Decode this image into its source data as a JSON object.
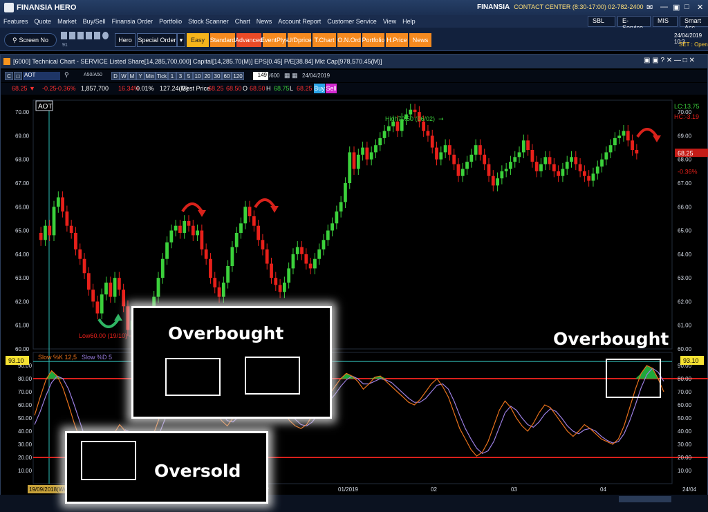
{
  "app": {
    "brand": "FINANSIA HERO",
    "contact_brand": "FINANSIA",
    "contact": "CONTACT CENTER (8:30-17:00) 02-782-2400"
  },
  "menu": [
    "Features",
    "Quote",
    "Market",
    "Buy/Sell",
    "Finansia Order",
    "Portfolio",
    "Stock Scanner",
    "Chart",
    "News",
    "Account Report",
    "Customer Service",
    "View",
    "Help"
  ],
  "menu_right": {
    "sbl": "SBL",
    "eservice": "E-Service",
    "mis": "MIS",
    "smart": "Smart Acc"
  },
  "toolbar": {
    "screen": "Screen No",
    "screen_sub": "91",
    "hero": "Hero",
    "special": "Special Order",
    "modes": [
      "Easy",
      "Standard",
      "Advanced"
    ],
    "links": [
      "EventPlys",
      "U/Dprice",
      "T.Chart",
      "O.N.Ord",
      "Portfolio",
      "H.Price",
      "News"
    ],
    "date": "24/04/2019 10:3",
    "set": "SET : Open"
  },
  "window": {
    "title": "[6000] Technical Chart - SERVICE Listed Share[14,285,700,000] Capital[14,285.70(M)] EPS[0.45] P/E[38.84] Mkt Cap[978,570.45(M)]"
  },
  "chartbar": {
    "symbol": "AOT",
    "ratio": "A50/A50",
    "periods": [
      "D",
      "W",
      "M",
      "Y",
      "Min",
      "Tick",
      "1",
      "3",
      "5",
      "10",
      "20",
      "30",
      "60",
      "120"
    ],
    "bars": "149",
    "bars_total": "/600",
    "date": "24/04/2019"
  },
  "pricebar": {
    "last": "68.25 ▼",
    "chg": "-0.25",
    "pct": "-0.36%",
    "vol": "1,857,700",
    "pct2": "16.34%",
    "pct3": "0.01%",
    "val": "127.24(M)",
    "best_label": "Best Price",
    "best_bid": "68.25",
    "best_ask": "68.50",
    "o_label": "O",
    "o": "68.50",
    "h_label": "H",
    "h": "68.75",
    "l_label": "L",
    "l": "68.25",
    "buy": "Buy",
    "sell": "Sell"
  },
  "colors": {
    "up": "#3bd13b",
    "down": "#e8201a",
    "accent": "#f7941d",
    "k": "#e8711c",
    "d": "#9a7ee0",
    "band": "#d9201b",
    "hc": "#34c6c0"
  },
  "chart_data": {
    "type": "candlestick",
    "symbol": "AOT",
    "price_ticks": [
      "70.00",
      "69.00",
      "68.00",
      "67.00",
      "66.00",
      "65.00",
      "64.00",
      "63.00",
      "62.00",
      "61.00",
      "60.00"
    ],
    "osc_ticks": [
      "90.00",
      "80.00",
      "70.00",
      "60.00",
      "50.00",
      "40.00",
      "30.00",
      "20.00",
      "10.00"
    ],
    "osc_current": "93.10",
    "x_labels": [
      "19/09/2018(Wed)",
      "10",
      "11",
      "12",
      "01/2019",
      "02",
      "03",
      "04",
      "24/04"
    ],
    "lc": "LC:13.75",
    "hc": "HC:-3.19",
    "last_price": "68.25",
    "last_pct": "-0.36%",
    "high_note": "High70.50 (06/02)",
    "low_note": "Low60.00 (19/10)",
    "stoch_k": "Slow %K 12,5",
    "stoch_d": "Slow %D 5",
    "overbought_level": 80,
    "oversold_level": 20,
    "closes": [
      64.6,
      65.2,
      64.8,
      66.0,
      66.4,
      65.8,
      65.2,
      64.9,
      64.2,
      63.8,
      63.2,
      62.5,
      62.0,
      61.5,
      62.3,
      62.8,
      62.2,
      63.0,
      62.5,
      61.8,
      60.8,
      61.2,
      60.5,
      60.2,
      60.8,
      61.5,
      62.2,
      63.0,
      63.8,
      64.5,
      65.0,
      65.2,
      64.9,
      65.4,
      65.2,
      64.8,
      65.0,
      64.2,
      63.8,
      63.0,
      62.6,
      62.2,
      62.8,
      63.5,
      64.3,
      64.9,
      65.3,
      66.0,
      65.6,
      65.2,
      64.6,
      64.2,
      63.6,
      63.0,
      62.7,
      62.4,
      62.8,
      63.4,
      64.0,
      64.3,
      64.0,
      63.6,
      63.4,
      63.8,
      64.2,
      64.6,
      65.0,
      65.3,
      65.8,
      66.2,
      67.0,
      68.3,
      67.6,
      68.2,
      68.5,
      68.0,
      68.3,
      68.6,
      68.9,
      69.2,
      69.4,
      69.6,
      69.2,
      69.7,
      69.9,
      70.1,
      70.0,
      69.6,
      69.2,
      69.0,
      68.5,
      68.0,
      68.3,
      68.6,
      68.2,
      67.8,
      67.3,
      67.6,
      67.9,
      68.2,
      68.6,
      68.2,
      67.8,
      67.3,
      66.9,
      67.2,
      67.5,
      67.6,
      67.9,
      68.1,
      68.3,
      68.8,
      68.4,
      67.9,
      67.5,
      67.8,
      68.1,
      67.8,
      67.5,
      67.3,
      67.6,
      67.9,
      68.1,
      67.8,
      67.5,
      67.3,
      67.1,
      67.4,
      67.7,
      68.0,
      68.3,
      68.6,
      68.9,
      69.0,
      69.2,
      68.8,
      68.4,
      68.25
    ],
    "stoch_k_series": [
      52,
      66,
      79,
      86,
      82,
      73,
      60,
      46,
      34,
      22,
      16,
      12,
      15,
      28,
      38,
      45,
      40,
      33,
      24,
      20,
      26,
      38,
      50,
      60,
      68,
      74,
      82,
      85,
      84,
      79,
      71,
      63,
      55,
      48,
      44,
      50,
      58,
      66,
      74,
      80,
      83,
      80,
      72,
      62,
      54,
      48,
      44,
      42,
      45,
      52,
      58,
      62,
      68,
      74,
      80,
      84,
      82,
      78,
      72,
      76,
      81,
      82,
      78,
      74,
      70,
      66,
      62,
      60,
      64,
      70,
      76,
      80,
      74,
      66,
      54,
      42,
      34,
      26,
      21,
      24,
      32,
      44,
      56,
      63,
      58,
      50,
      44,
      40,
      46,
      54,
      60,
      58,
      52,
      46,
      40,
      36,
      40,
      45,
      42,
      38,
      34,
      32,
      30,
      34,
      44,
      58,
      72,
      84,
      90,
      88,
      80,
      70
    ],
    "stoch_d_series": [
      45,
      55,
      67,
      77,
      82,
      80,
      72,
      60,
      47,
      34,
      24,
      17,
      14,
      18,
      27,
      37,
      41,
      39,
      32,
      26,
      23,
      28,
      38,
      49,
      59,
      67,
      74,
      80,
      84,
      82,
      77,
      70,
      62,
      54,
      48,
      47,
      51,
      58,
      66,
      73,
      79,
      81,
      78,
      71,
      63,
      55,
      49,
      45,
      44,
      47,
      53,
      58,
      63,
      68,
      74,
      79,
      82,
      80,
      76,
      76,
      78,
      80,
      79,
      77,
      73,
      69,
      65,
      62,
      62,
      65,
      70,
      75,
      76,
      72,
      63,
      52,
      42,
      34,
      27,
      23,
      25,
      32,
      43,
      54,
      59,
      56,
      50,
      45,
      43,
      47,
      53,
      57,
      55,
      50,
      44,
      40,
      38,
      41,
      42,
      40,
      36,
      33,
      31,
      32,
      38,
      48,
      60,
      73,
      83,
      88,
      85,
      78
    ]
  },
  "annotations": {
    "overbought_1": "Overbought",
    "overbought_2": "Overbought",
    "oversold": "Oversold"
  }
}
